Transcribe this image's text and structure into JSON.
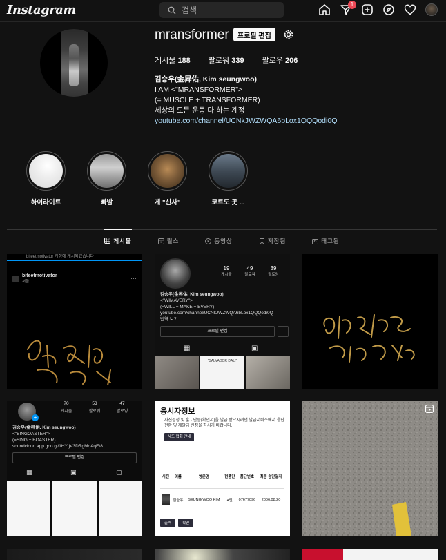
{
  "topbar": {
    "logo": "Instagram",
    "search_placeholder": "검색",
    "notification_count": "1"
  },
  "profile": {
    "username": "mransformer",
    "edit_button": "프로필 편집",
    "stats": {
      "posts_label": "게시물",
      "posts_count": "188",
      "followers_label": "팔로워",
      "followers_count": "339",
      "following_label": "팔로우",
      "following_count": "206"
    },
    "bio": {
      "name": "김승우(金昇佑, Kim seungwoo)",
      "line1": "I AM <\"MRANSFORMER\">",
      "line2": "(= MUSCLE + TRANSFORMER)",
      "line3": "세상의 모든 운동 다 하는 계정",
      "link": "youtube.com/channel/UCNkJWZWQA6bLox1QQQodi0Q"
    }
  },
  "highlights": [
    {
      "label": "하이라이트"
    },
    {
      "label": "빠밤"
    },
    {
      "label": "게 \"신사\""
    },
    {
      "label": "코트도 곳 ..."
    }
  ],
  "tabs": [
    {
      "label": "게시물",
      "active": true
    },
    {
      "label": "릴스"
    },
    {
      "label": "동영상"
    },
    {
      "label": "저장됨"
    },
    {
      "label": "태그됨"
    }
  ],
  "posts": {
    "p1": {
      "header": "biteetmotivator 계정에 게시되었습니다",
      "account": "biteetmotivator",
      "location": "서울"
    },
    "p2": {
      "posts_count": "19",
      "posts_label": "게시물",
      "followers_count": "49",
      "followers_label": "팔로워",
      "following_count": "39",
      "following_label": "팔로잉",
      "name": "김승우(金昇佑, Kim seungwoo)",
      "line1": "<\"WIMAVERY\">",
      "line2": "(=WILL + MAKE + EVERY)",
      "link": "youtube.com/channel/UCNkJWZWQA6bLox1QQQodi0Q",
      "translate": "번역 보기",
      "edit_button": "프로필 편집",
      "thumb_caption": "\"SALVADOR DALI\""
    },
    "p4": {
      "posts_count": "70",
      "posts_label": "게시물",
      "followers_count": "53",
      "followers_label": "팔로워",
      "following_count": "47",
      "following_label": "팔로잉",
      "name": "김승우(金昇佑, Kim seungwoo)",
      "line1": "<\"BINGOASTER\">",
      "line2": "(=SING + BOASTER)",
      "link": "soundcloud.app.goo.gl/1HYtjV3DRgMqAqEt8",
      "edit_button": "프로필 편집"
    },
    "p5": {
      "title": "응시자정보",
      "desc": "사진정정 및 훈 · 단증(확인서)을 발급 받으시려면 발급서비스에서 응단전환 및 재발급 신청을 하시기 바랍니다.",
      "button": "사도 협회 안내",
      "headers": [
        "사진",
        "이름",
        "영문명",
        "현품단",
        "품단번호",
        "최종 승단일자"
      ],
      "row": [
        "",
        "김승우",
        "SEUNG WOO KIM",
        "4단",
        "07677096",
        "2006.08.20"
      ],
      "print": "출력",
      "confirm": "확인"
    }
  },
  "colors": {
    "background": "#121212",
    "link": "#b2dffc",
    "badge": "#ed4956",
    "accent": "#0095f6"
  }
}
